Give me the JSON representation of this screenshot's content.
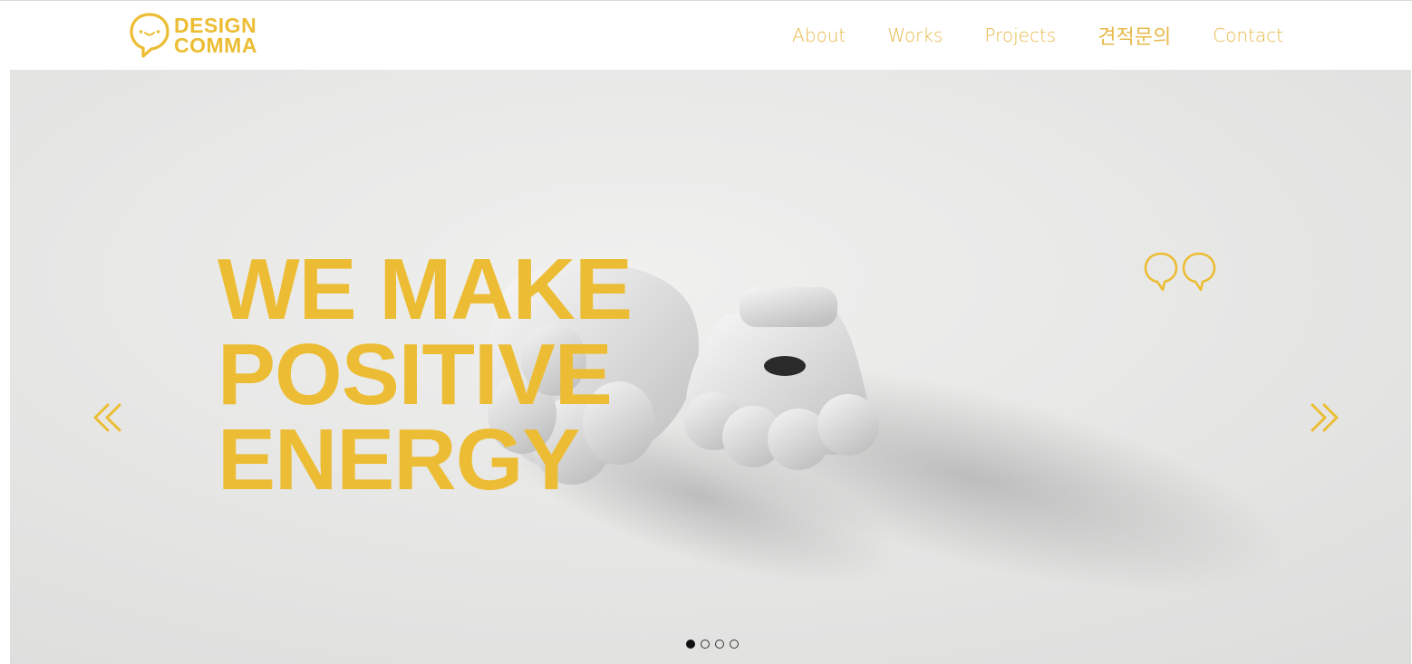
{
  "colors": {
    "brand_yellow": "#ecbd34",
    "nav_text": "#e8b94a",
    "hero_bg": "#e6e6e5"
  },
  "header": {
    "logo": {
      "line1": "DESIGN",
      "line2": "COMMA",
      "icon": "speech-bubble-smile-icon"
    },
    "nav": [
      {
        "label": "About"
      },
      {
        "label": "Works"
      },
      {
        "label": "Projects"
      },
      {
        "label": "견적문의"
      },
      {
        "label": "Contact"
      }
    ]
  },
  "hero": {
    "headline": [
      "WE MAKE",
      "POSITIVE",
      "ENERGY"
    ],
    "quote_icon": "double-speech-bubble-icon",
    "prev_icon": "double-chevron-left-icon",
    "next_icon": "double-chevron-right-icon",
    "slider": {
      "total": 4,
      "active_index": 0
    }
  }
}
